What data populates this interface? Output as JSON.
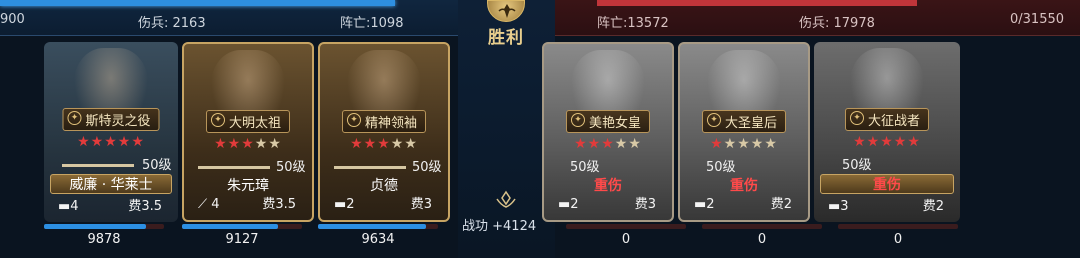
{
  "battle": {
    "result": "胜利",
    "merit": "战功 +4124"
  },
  "left_side": {
    "stats": {
      "troops": "900",
      "wounded": "伤兵: 2163",
      "killed": "阵亡:1098"
    },
    "color": "#2e8fe0",
    "heroes": [
      {
        "title": "斯特灵之役",
        "stars_on": 5,
        "stars_total": 5,
        "level": "50级",
        "name": "威廉 · 华莱士",
        "unit_icon": "tank-icon",
        "unit_count": "4",
        "cost": "费3.5",
        "troops": "9878",
        "troop_fill": 0.85
      },
      {
        "title": "大明太祖",
        "stars_on": 3,
        "stars_total": 5,
        "level": "50级",
        "name": "朱元璋",
        "unit_icon": "rifle-icon",
        "unit_count": "4",
        "cost": "费3.5",
        "troops": "9127",
        "troop_fill": 0.8
      },
      {
        "title": "精神领袖",
        "stars_on": 3,
        "stars_total": 5,
        "level": "50级",
        "name": "贞德",
        "unit_icon": "tank-icon",
        "unit_count": "2",
        "cost": "费3",
        "troops": "9634",
        "troop_fill": 0.9
      }
    ]
  },
  "right_side": {
    "stats": {
      "killed": "阵亡:13572",
      "wounded": "伤兵: 17978",
      "troops": "0/31550"
    },
    "color": "#c0353a",
    "heroes": [
      {
        "title": "美艳女皇",
        "stars_on": 3,
        "stars_total": 5,
        "level": "50级",
        "name": "重伤",
        "unit_icon": "tank-icon",
        "unit_count": "2",
        "cost": "费3",
        "troops": "0",
        "troop_fill": 0
      },
      {
        "title": "大圣皇后",
        "stars_on": 1,
        "stars_total": 5,
        "level": "50级",
        "name": "重伤",
        "unit_icon": "tank-icon",
        "unit_count": "2",
        "cost": "费2",
        "troops": "0",
        "troop_fill": 0
      },
      {
        "title": "大征战者",
        "stars_on": 5,
        "stars_total": 5,
        "level": "50级",
        "name": "重伤",
        "unit_icon": "tank-icon",
        "unit_count": "3",
        "cost": "费2",
        "troops": "0",
        "troop_fill": 0
      }
    ]
  }
}
